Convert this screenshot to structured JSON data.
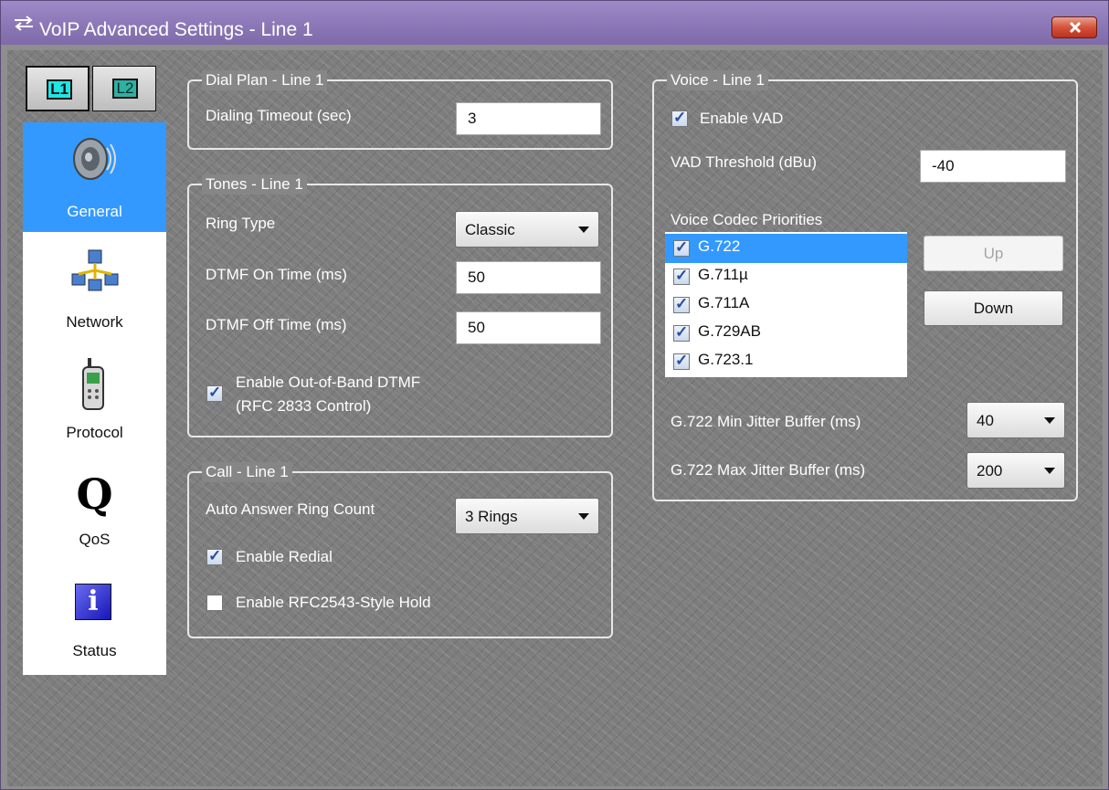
{
  "window": {
    "title": "VoIP Advanced Settings - Line 1"
  },
  "line_buttons": [
    "L1",
    "L2"
  ],
  "nav": [
    {
      "label": "General",
      "icon": "speaker-icon",
      "selected": true
    },
    {
      "label": "Network",
      "icon": "network-icon"
    },
    {
      "label": "Protocol",
      "icon": "phone-icon"
    },
    {
      "label": "QoS",
      "icon": "q-icon"
    },
    {
      "label": "Status",
      "icon": "info-icon"
    }
  ],
  "dial_plan": {
    "legend": "Dial Plan - Line 1",
    "timeout_label": "Dialing Timeout (sec)",
    "timeout_value": "3"
  },
  "tones": {
    "legend": "Tones - Line 1",
    "ring_type_label": "Ring Type",
    "ring_type_value": "Classic",
    "dtmf_on_label": "DTMF On Time (ms)",
    "dtmf_on_value": "50",
    "dtmf_off_label": "DTMF Off Time (ms)",
    "dtmf_off_value": "50",
    "oob_label_1": "Enable Out-of-Band DTMF",
    "oob_label_2": "(RFC 2833 Control)",
    "oob_checked": true
  },
  "call": {
    "legend": "Call - Line 1",
    "auto_answer_label": "Auto Answer Ring Count",
    "auto_answer_value": "3 Rings",
    "redial_label": "Enable Redial",
    "redial_checked": true,
    "hold_label": "Enable RFC2543-Style Hold",
    "hold_checked": false
  },
  "voice": {
    "legend": "Voice - Line 1",
    "vad_label": "Enable VAD",
    "vad_checked": true,
    "vad_threshold_label": "VAD Threshold (dBu)",
    "vad_threshold_value": "-40",
    "codec_label": "Voice Codec Priorities",
    "codecs": [
      {
        "name": "G.722",
        "checked": true,
        "selected": true
      },
      {
        "name": "G.711µ",
        "checked": true
      },
      {
        "name": "G.711A",
        "checked": true
      },
      {
        "name": "G.729AB",
        "checked": true
      },
      {
        "name": "G.723.1",
        "checked": true
      }
    ],
    "up_label": "Up",
    "down_label": "Down",
    "min_jitter_label": "G.722 Min Jitter Buffer (ms)",
    "min_jitter_value": "40",
    "max_jitter_label": "G.722 Max Jitter Buffer (ms)",
    "max_jitter_value": "200"
  }
}
